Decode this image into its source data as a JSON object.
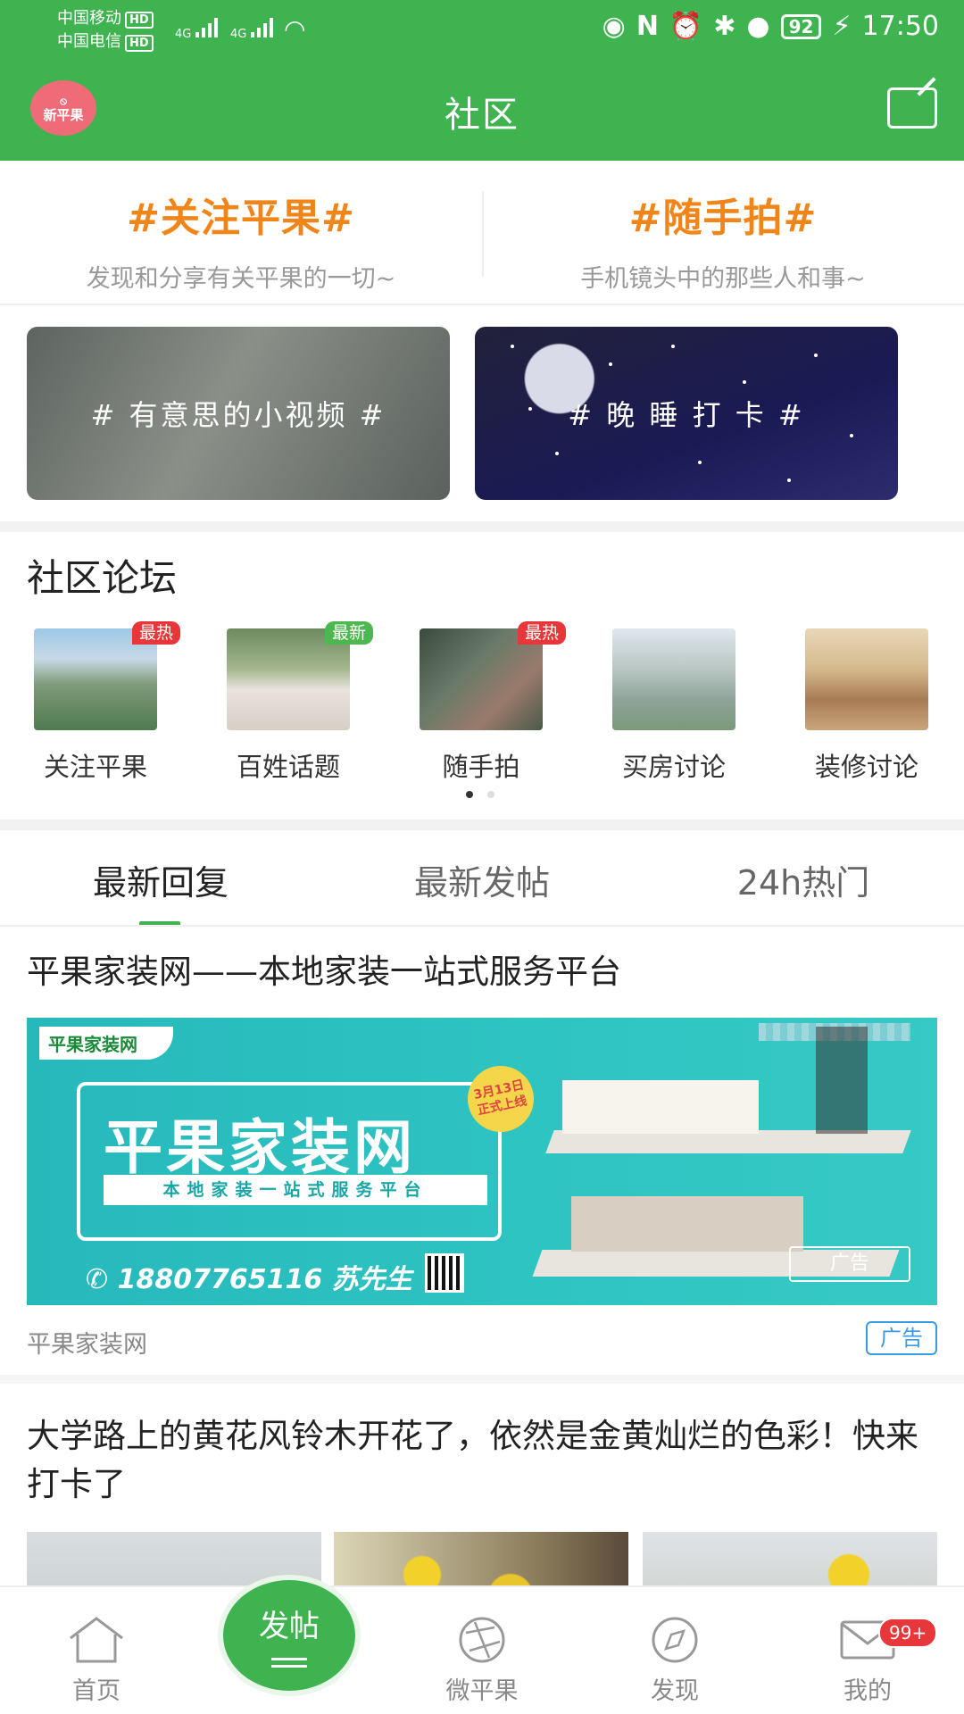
{
  "status_bar": {
    "carrier1": "中国移动",
    "carrier2": "中国电信",
    "hd": "HD",
    "net1": "4G",
    "net2": "4G",
    "battery": "92",
    "time": "17:50"
  },
  "header": {
    "logo_text": "新平果",
    "title": "社区"
  },
  "topics": [
    {
      "title": "#关注平果#",
      "subtitle": "发现和分享有关平果的一切~"
    },
    {
      "title": "#随手拍#",
      "subtitle": "手机镜头中的那些人和事~"
    }
  ],
  "banners": [
    {
      "label": "# 有意思的小视频 #"
    },
    {
      "label": "# 晚 睡 打 卡 #"
    }
  ],
  "forum": {
    "title": "社区论坛",
    "items": [
      {
        "label": "关注平果",
        "tag": "最热"
      },
      {
        "label": "百姓话题",
        "tag": "最新"
      },
      {
        "label": "随手拍",
        "tag": "最热"
      },
      {
        "label": "买房讨论",
        "tag": ""
      },
      {
        "label": "装修讨论",
        "tag": ""
      }
    ]
  },
  "tabs": [
    "最新回复",
    "最新发帖",
    "24h热门"
  ],
  "posts": [
    {
      "title": "平果家装网——本地家装一站式服务平台",
      "source": "平果家装网",
      "ad_label": "广告",
      "ad": {
        "logo": "平果家装网",
        "name": "平果家装网",
        "sub": "本地家装一站式服务平台",
        "phone": "18807765116 苏先生",
        "badge": "3月13日 正式上线",
        "mark": "广告"
      }
    },
    {
      "title": "大学路上的黄花风铃木开花了，依然是金黄灿烂的色彩！快来打卡了"
    }
  ],
  "bottom_nav": {
    "home": "首页",
    "post": "发帖",
    "weipingguo": "微平果",
    "discover": "发现",
    "mine": "我的",
    "mine_badge": "99+"
  },
  "colors": {
    "brand_green": "#3fb34f",
    "orange": "#f0861a",
    "hot_red": "#e8373b"
  }
}
